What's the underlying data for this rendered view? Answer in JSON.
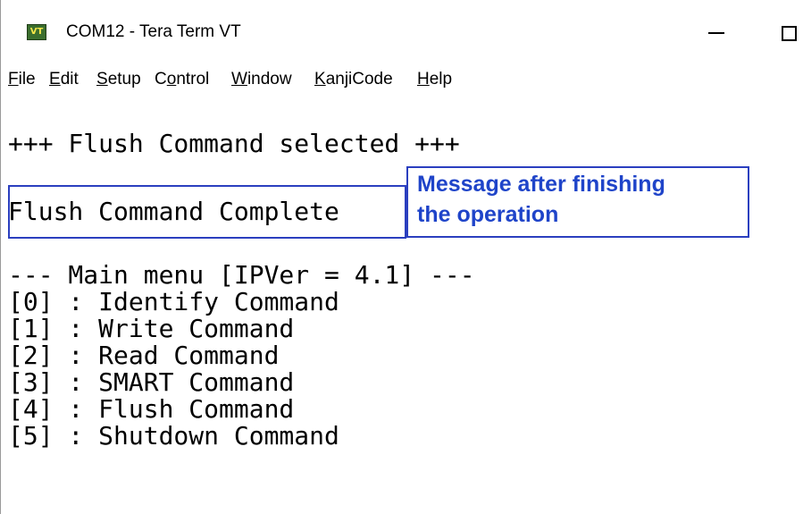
{
  "window": {
    "title": "COM12 - Tera Term VT",
    "icon": "VT",
    "icon_name": "tera-term-vt-icon",
    "controls": {
      "minimize": "minimize-icon",
      "maximize": "maximize-icon"
    }
  },
  "menubar": {
    "items": [
      {
        "accel": "F",
        "rest": "ile"
      },
      {
        "accel": "E",
        "rest": "dit"
      },
      {
        "accel": "S",
        "rest": "etup"
      },
      {
        "pre": "C",
        "accel": "o",
        "rest": "ntrol"
      },
      {
        "accel": "W",
        "rest": "indow"
      },
      {
        "accel": "K",
        "rest": "anjiCode"
      },
      {
        "accel": "H",
        "rest": "elp"
      }
    ]
  },
  "terminal": {
    "lines": [
      "+++ Flush Command selected +++",
      "Flush Command Complete",
      "--- Main menu [IPVer = 4.1] ---",
      "[0] : Identify Command",
      "[1] : Write Command",
      "[2] : Read Command",
      "[3] : SMART Command",
      "[4] : Flush Command",
      "[5] : Shutdown Command"
    ]
  },
  "annotation": {
    "line1": "Message after finishing",
    "line2": "the operation",
    "color": "#1f44c9",
    "border_color": "#2b3fbf"
  }
}
